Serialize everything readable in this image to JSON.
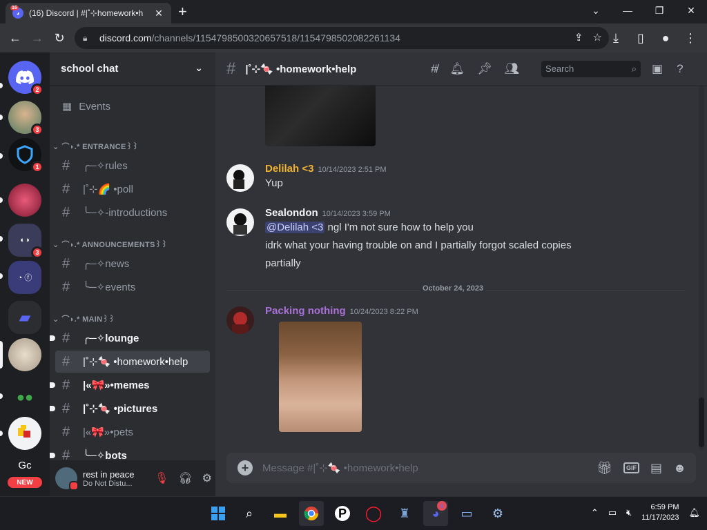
{
  "browser": {
    "tab_title": "(16) Discord | #|˚⊹homework•h",
    "tab_badge": "16",
    "url_host": "discord.com",
    "url_path": "/channels/1154798500320657518/1154798502082261134"
  },
  "servers": [
    {
      "name": "discord-home",
      "badge": "2"
    },
    {
      "name": "server-avatar-boy",
      "badge": "3"
    },
    {
      "name": "server-shield",
      "badge": "1"
    },
    {
      "name": "server-pink",
      "badge": ""
    },
    {
      "name": "server-folder-mixed",
      "badge": "3"
    },
    {
      "name": "server-blue-circle",
      "badge": ""
    },
    {
      "name": "server-folder",
      "badge": ""
    },
    {
      "name": "server-dog",
      "badge": ""
    },
    {
      "name": "server-frogs",
      "badge": ""
    },
    {
      "name": "server-roblox",
      "badge": ""
    },
    {
      "name": "server-gc",
      "label": "Gc"
    }
  ],
  "new_badge": "NEW",
  "server": {
    "name": "school chat",
    "events_label": "Events"
  },
  "categories": [
    {
      "label": "⌒◗.* ENTRANCE꒱꒱"
    },
    {
      "label": "⌒◗.* ANNOUNCEMENTS꒱꒱"
    },
    {
      "label": "⌒◗.* MAIN꒱꒱"
    }
  ],
  "channels": [
    {
      "label": "╭─✧rules"
    },
    {
      "label": "|˚⊹🌈 •poll"
    },
    {
      "label": "╰─✧-introductions"
    },
    {
      "label": "╭─✧news"
    },
    {
      "label": "╰─✧events"
    },
    {
      "label": "╭─✧lounge"
    },
    {
      "label": "|˚⊹🍬 •homework•help"
    },
    {
      "label": "|«🎀»•memes"
    },
    {
      "label": "|˚⊹🍬 •pictures"
    },
    {
      "label": "|«🎀»•pets"
    },
    {
      "label": "╰─✧bots"
    }
  ],
  "user": {
    "name": "rest in peace",
    "status": "Do Not Distu..."
  },
  "header": {
    "channel_name": "|˚⊹🍬 •homework•help",
    "search_placeholder": "Search"
  },
  "messages": [
    {
      "author": "Delilah <3",
      "color": "#f0b232",
      "time": "10/14/2023 2:51 PM",
      "lines": [
        "Yup"
      ]
    },
    {
      "author": "Sealondon",
      "color": "#f2f3f5",
      "time": "10/14/2023 3:59 PM",
      "mention": "@Delilah <3",
      "lines": [
        " ngl I'm not sure how to help you",
        "idrk what your having trouble on and I partially forgot scaled copies",
        "partially"
      ]
    },
    {
      "author": "Packing nothing",
      "color": "#a970d6",
      "time": "10/24/2023 8:22 PM",
      "lines": []
    }
  ],
  "date_divider": "October 24, 2023",
  "composer_placeholder": "Message #|˚⊹🍬 •homework•help",
  "taskbar": {
    "discord_badge": "6",
    "time": "6:59 PM",
    "date": "11/17/2023"
  }
}
